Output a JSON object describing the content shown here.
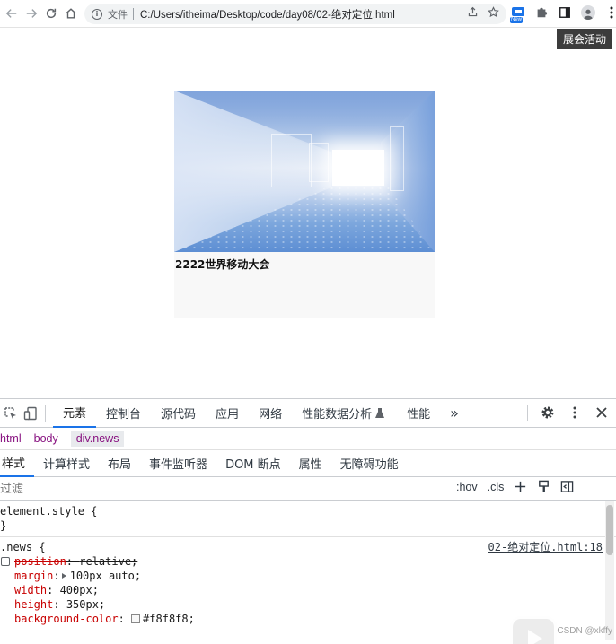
{
  "browser": {
    "scheme_label": "文件",
    "url": "C:/Users/itheima/Desktop/code/day08/02-绝对定位.html",
    "new_badge": "New"
  },
  "page": {
    "fixed_tag": "展会活动",
    "news_title": "2222世界移动大会"
  },
  "devtools": {
    "tabs": [
      "元素",
      "控制台",
      "源代码",
      "应用",
      "网络",
      "性能数据分析",
      "性能"
    ],
    "more_label": "»",
    "breadcrumbs": [
      "html",
      "body",
      "div.news"
    ],
    "sub_tabs": [
      "样式",
      "计算样式",
      "布局",
      "事件监听器",
      "DOM 断点",
      "属性",
      "无障碍功能"
    ],
    "filter_placeholder": "过滤",
    "hov_label": ":hov",
    "cls_label": ".cls",
    "element_style_selector": "element.style {",
    "close_brace": "}",
    "news_rule": {
      "selector": ".news {",
      "source": "02-绝对定位.html:18",
      "decls": [
        {
          "prop": "position",
          "value": "relative;"
        },
        {
          "prop": "margin",
          "value": "100px auto;"
        },
        {
          "prop": "width",
          "value": "400px;"
        },
        {
          "prop": "height",
          "value": "350px;"
        },
        {
          "prop": "background-color",
          "value": "#f8f8f8;"
        }
      ]
    },
    "swatch_color": "#f8f8f8"
  },
  "watermark": "CSDN @xkffy"
}
